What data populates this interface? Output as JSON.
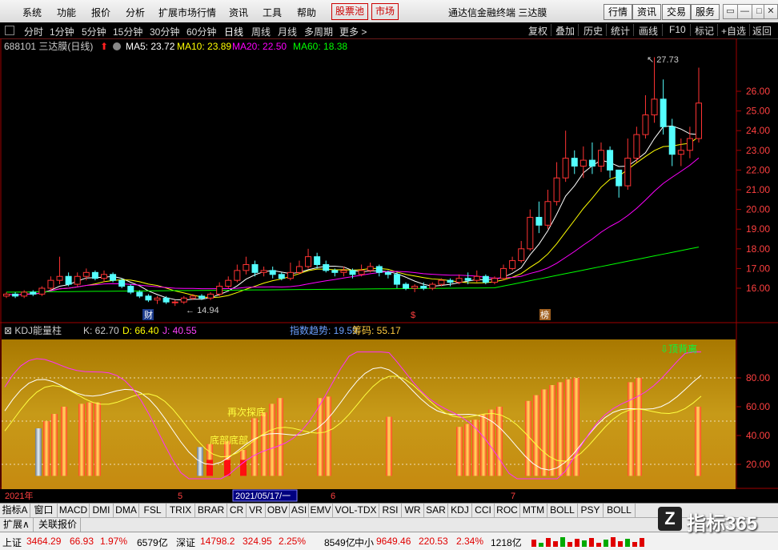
{
  "menu": {
    "items": [
      "系统",
      "功能",
      "报价",
      "分析",
      "扩展市场行情",
      "资讯",
      "工具",
      "帮助"
    ],
    "boxed": [
      "股票池",
      "市场"
    ],
    "title": "通达信金融终端  三达膜",
    "right_buttons": [
      "行情",
      "资讯",
      "交易",
      "服务"
    ],
    "window_controls": [
      "▭",
      "—",
      "□",
      "✕"
    ]
  },
  "periods": {
    "items": [
      "分时",
      "1分钟",
      "5分钟",
      "15分钟",
      "30分钟",
      "60分钟",
      "日线",
      "周线",
      "月线",
      "多周期",
      "更多 >"
    ],
    "active": "日线",
    "tools": [
      "复权",
      "叠加",
      "历史",
      "统计",
      "画线",
      "F10",
      "标记",
      "+自选",
      "返回"
    ]
  },
  "main_chart": {
    "stock": "688101 三达膜(日线)",
    "ma_labels": [
      {
        "name": "MA5:",
        "value": "23.72",
        "color": "#ffffff"
      },
      {
        "name": "MA10:",
        "value": "23.89",
        "color": "#ffff00"
      },
      {
        "name": "MA20:",
        "value": "22.50",
        "color": "#ff00ff"
      },
      {
        "name": "MA60:",
        "value": "18.38",
        "color": "#00ff00"
      }
    ],
    "price_axis": [
      "26.00",
      "25.00",
      "24.00",
      "23.00",
      "22.00",
      "21.00",
      "20.00",
      "19.00",
      "18.00",
      "17.00",
      "16.00"
    ],
    "high_label": "27.73",
    "low_label": "14.94",
    "event_markers": [
      "财",
      "$",
      "榜"
    ]
  },
  "kdj_panel": {
    "title": "KDJ能量柱",
    "k": "K: 62.70",
    "d": "D: 66.40",
    "j": "J: 40.55",
    "trend": "指数趋势: 19.59",
    "chip": "筹码: 55.17",
    "axis": [
      "80.00",
      "60.00",
      "40.00",
      "20.00"
    ],
    "annotations": [
      "再次探底",
      "底部底部",
      "顶背离"
    ]
  },
  "date_axis": {
    "labels": [
      "2021年",
      "5",
      "2021/05/17/一",
      "6",
      "7"
    ]
  },
  "indicator_tabs": [
    "指标A",
    "窗口",
    "MACD",
    "DMI",
    "DMA",
    "FSL",
    "TRIX",
    "BRAR",
    "CR",
    "VR",
    "OBV",
    "ASI",
    "EMV",
    "VOL-TDX",
    "RSI",
    "WR",
    "SAR",
    "KDJ",
    "CCI",
    "ROC",
    "MTM",
    "BOLL",
    "PSY",
    "BOLL"
  ],
  "expand_tabs": [
    "扩展∧",
    "关联报价"
  ],
  "status": {
    "sh": {
      "name": "上证",
      "value": "3464.29",
      "change": "66.93",
      "pct": "1.97%",
      "amount": "6579亿"
    },
    "sz": {
      "name": "深证",
      "value": "14798.2",
      "change": "324.95",
      "pct": "2.25%",
      "amount": "8549亿"
    },
    "zx": {
      "name": "中小",
      "value": "9649.46",
      "change": "220.53",
      "pct": "2.34%",
      "amount": "1218亿"
    }
  },
  "logo_text": "指标365",
  "colors": {
    "up": "#ff3333",
    "down": "#54ffff",
    "panel_bg": "#b58700",
    "accent": "#e00000"
  }
}
